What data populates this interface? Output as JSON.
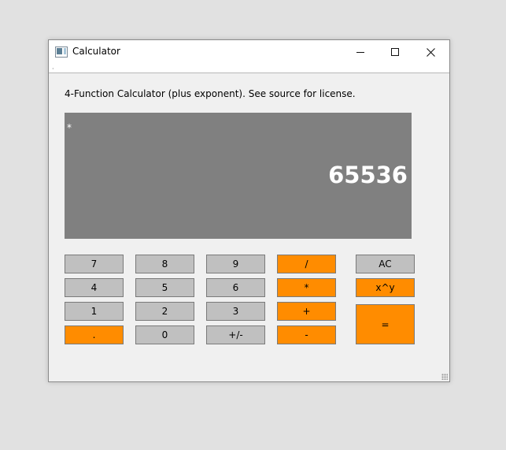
{
  "window": {
    "title": "Calculator",
    "icon": "calculator-app-icon",
    "controls": [
      "minimize-icon",
      "maximize-icon",
      "close-icon"
    ]
  },
  "menubar": {
    "marker": "·"
  },
  "description": "4-Function Calculator (plus exponent). See source for license.",
  "display": {
    "indicator": "*",
    "value": "65536",
    "background": "#808080",
    "text_color": "#ffffff"
  },
  "buttons": {
    "seven": "7",
    "eight": "8",
    "nine": "9",
    "divide": "/",
    "clear": "AC",
    "four": "4",
    "five": "5",
    "six": "6",
    "multiply": "*",
    "power": "x^y",
    "one": "1",
    "two": "2",
    "three": "3",
    "add": "+",
    "equals": "=",
    "decimal": ".",
    "zero": "0",
    "negate": "+/-",
    "subtract": "-"
  },
  "colors": {
    "digit_button": "#c0c0c0",
    "operator_button": "#ff8c00",
    "window_bg": "#f0f0f0",
    "desktop_bg": "#e1e1e1"
  }
}
